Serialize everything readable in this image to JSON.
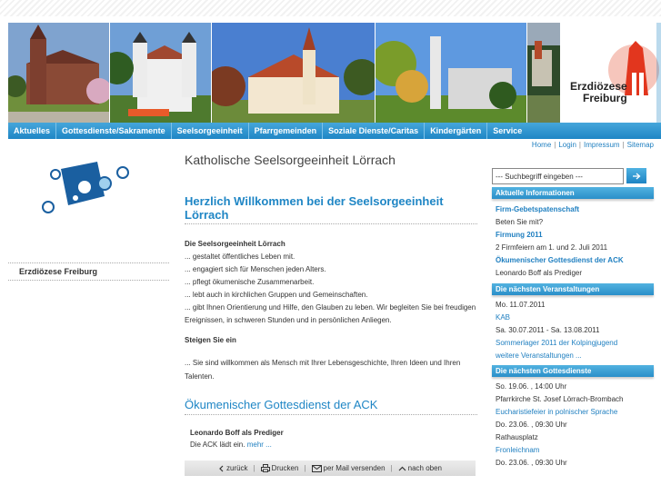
{
  "brand": {
    "name_line1": "Erzdiözese",
    "name_line2": "Freiburg"
  },
  "nav": [
    "Aktuelles",
    "Gottesdienste/Sakramente",
    "Seelsorgeeinheit",
    "Pfarrgemeinden",
    "Soziale Dienste/Caritas",
    "Kindergärten",
    "Service"
  ],
  "utility": {
    "home": "Home",
    "login": "Login",
    "impressum": "Impressum",
    "sitemap": "Sitemap",
    "sep": "|"
  },
  "sidebar": {
    "item": "Erzdiözese Freiburg"
  },
  "main": {
    "page_title": "Katholische Seelsorgeeinheit Lörrach",
    "welcome": "Herzlich Willkommen bei der Seelsorgeeinheit Lörrach",
    "intro_head": "Die Seelsorgeeinheit Lörrach",
    "intro_lines": [
      "... gestaltet öffentliches Leben mit.",
      "... engagiert sich für Menschen jeden Alters.",
      "... pflegt ökumenische Zusammenarbeit.",
      "... lebt auch in kirchlichen Gruppen und Gemeinschaften.",
      "... gibt Ihnen Orientierung und Hilfe, den Glauben zu leben. Wir begleiten Sie bei freudigen Ereignissen, in schweren Stunden und in persönlichen Anliegen."
    ],
    "steigen": "Steigen Sie ein",
    "willkommen": "... Sie sind willkommen als Mensch mit Ihrer Lebensgeschichte, Ihren Ideen und Ihren Talenten.",
    "ack_title": "Ökumenischer Gottesdienst der ACK",
    "ack_sub": "Leonardo Boff als Prediger",
    "ack_text": "Die ACK lädt ein. ",
    "ack_more": "mehr ..."
  },
  "actions": {
    "back": "zurück",
    "print": "Drucken",
    "mail": "per Mail versenden",
    "top": "nach oben",
    "sep": "|"
  },
  "right": {
    "search_placeholder": "--- Suchbegriff eingeben ---",
    "info_head": "Aktuelle Informationen",
    "info": [
      {
        "text": "Firm-Gebetspatenschaft",
        "style": "bold-link"
      },
      {
        "text": "Beten Sie mit?",
        "style": "text"
      },
      {
        "text": "Firmung 2011",
        "style": "bold-link"
      },
      {
        "text": "2 Firmfeiern am 1. und 2. Juli 2011",
        "style": "text"
      },
      {
        "text": "Ökumenischer Gottesdienst der ACK",
        "style": "bold-link"
      },
      {
        "text": "Leonardo Boff als Prediger",
        "style": "text"
      }
    ],
    "events_head": "Die nächsten Veranstaltungen",
    "events": [
      {
        "text": "Mo. 11.07.2011",
        "style": "text"
      },
      {
        "text": "KAB",
        "style": "link"
      },
      {
        "text": "Sa. 30.07.2011 - Sa. 13.08.2011",
        "style": "text"
      },
      {
        "text": "Sommerlager 2011 der Kolpingjugend",
        "style": "link"
      },
      {
        "text": "weitere Veranstaltungen ...",
        "style": "link"
      }
    ],
    "services_head": "Die nächsten Gottesdienste",
    "services": [
      {
        "text": "So. 19.06. , 14:00 Uhr",
        "style": "text"
      },
      {
        "text": "Pfarrkirche St. Josef Lörrach-Brombach",
        "style": "text"
      },
      {
        "text": "Eucharistiefeier in polnischer Sprache",
        "style": "link"
      },
      {
        "text": "Do. 23.06. , 09:30 Uhr",
        "style": "text"
      },
      {
        "text": "Rathausplatz",
        "style": "text"
      },
      {
        "text": "Fronleichnam",
        "style": "link"
      },
      {
        "text": "Do. 23.06. , 09:30 Uhr",
        "style": "text"
      }
    ]
  },
  "colors": {
    "accent": "#1f86c5",
    "link": "#1f7fc0",
    "logo_blue": "#1a5fa0"
  }
}
